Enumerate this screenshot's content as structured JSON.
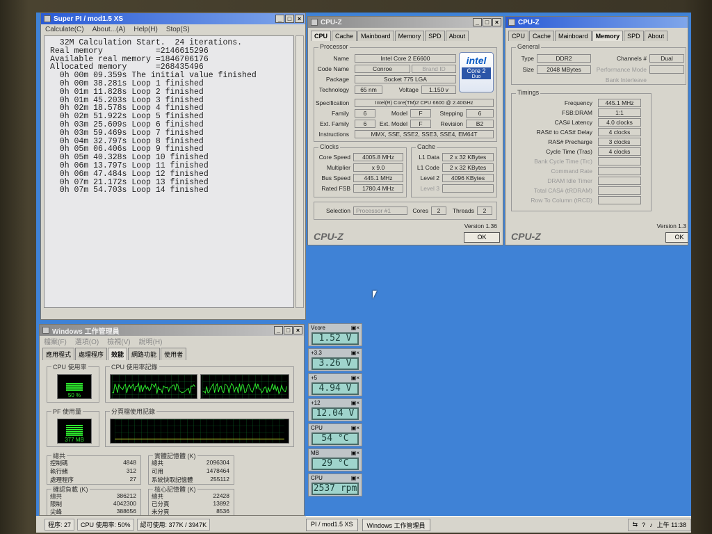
{
  "superpi": {
    "title": "Super PI / mod1.5 XS",
    "menu": [
      "Calculate(C)",
      "About...(A)",
      "Help(H)",
      "Stop(S)"
    ],
    "log": [
      "  32M Calculation Start.  24 iterations.",
      "Real memory           =2146615296",
      "Available real memory =1846706176",
      "Allocated memory      =268435496",
      "  0h 00m 09.359s The initial value finished",
      "  0h 00m 38.281s Loop 1 finished",
      "  0h 01m 11.828s Loop 2 finished",
      "  0h 01m 45.203s Loop 3 finished",
      "  0h 02m 18.578s Loop 4 finished",
      "  0h 02m 51.922s Loop 5 finished",
      "  0h 03m 25.609s Loop 6 finished",
      "  0h 03m 59.469s Loop 7 finished",
      "  0h 04m 32.797s Loop 8 finished",
      "  0h 05m 06.406s Loop 9 finished",
      "  0h 05m 40.328s Loop 10 finished",
      "  0h 06m 13.797s Loop 11 finished",
      "  0h 06m 47.484s Loop 12 finished",
      "  0h 07m 21.172s Loop 13 finished",
      "  0h 07m 54.703s Loop 14 finished"
    ]
  },
  "cpuz1": {
    "title": "CPU-Z",
    "tabs": [
      "CPU",
      "Cache",
      "Mainboard",
      "Memory",
      "SPD",
      "About"
    ],
    "processor_label": "Processor",
    "name_label": "Name",
    "name": "Intel Core 2 E6600",
    "codename_label": "Code Name",
    "codename": "Conroe",
    "brandid": "Brand ID",
    "package_label": "Package",
    "package": "Socket 775 LGA",
    "technology_label": "Technology",
    "technology": "65 nm",
    "voltage_label": "Voltage",
    "voltage": "1.150 v",
    "spec_label": "Specification",
    "spec": "Intel(R) Core(TM)2 CPU         6600  @ 2.40GHz",
    "family_label": "Family",
    "family": "6",
    "model_label": "Model",
    "model": "F",
    "stepping_label": "Stepping",
    "stepping": "6",
    "extfamily_label": "Ext. Family",
    "extfamily": "6",
    "extmodel_label": "Ext. Model",
    "extmodel": "F",
    "revision_label": "Revision",
    "revision": "B2",
    "instr_label": "Instructions",
    "instr": "MMX, SSE, SSE2, SSE3, SSE4, EM64T",
    "clocks_label": "Clocks",
    "corespeed_label": "Core Speed",
    "corespeed": "4005.8 MHz",
    "multiplier_label": "Multiplier",
    "multiplier": "x 9.0",
    "busspeed_label": "Bus Speed",
    "busspeed": "445.1 MHz",
    "ratedfsb_label": "Rated FSB",
    "ratedfsb": "1780.4 MHz",
    "cache_label": "Cache",
    "l1data_label": "L1 Data",
    "l1data": "2 x 32 KBytes",
    "l1code_label": "L1 Code",
    "l1code": "2 x 32 KBytes",
    "level2_label": "Level 2",
    "level2": "4096 KBytes",
    "level3_label": "Level 3",
    "selection_label": "Selection",
    "selection": "Processor #1",
    "cores_label": "Cores",
    "cores": "2",
    "threads_label": "Threads",
    "threads": "2",
    "version": "Version 1.36",
    "brand": "CPU-Z",
    "ok": "OK",
    "logo_intel": "intel",
    "logo_core2": "Core 2",
    "logo_duo": "Duo"
  },
  "cpuz2": {
    "title": "CPU-Z",
    "tabs": [
      "CPU",
      "Cache",
      "Mainboard",
      "Memory",
      "SPD",
      "About"
    ],
    "general_label": "General",
    "type_label": "Type",
    "type": "DDR2",
    "size_label": "Size",
    "size": "2048 MBytes",
    "channels_label": "Channels #",
    "channels": "Dual",
    "perfmode_label": "Performance Mode",
    "bankinter_label": "Bank Interleave",
    "timings_label": "Timings",
    "freq_label": "Frequency",
    "freq": "445.1 MHz",
    "fsbdram_label": "FSB:DRAM",
    "fsbdram": "1:1",
    "cas_label": "CAS# Latency",
    "cas": "4.0 clocks",
    "rcd_label": "RAS# to CAS# Delay",
    "rcd": "4 clocks",
    "rp_label": "RAS# Precharge",
    "rp": "3 clocks",
    "tras_label": "Cycle Time (Tras)",
    "tras": "4 clocks",
    "trc_label": "Bank Cycle Time (Trc)",
    "cr_label": "Command Rate",
    "idle_label": "DRAM Idle Timer",
    "rdram_label": "Total CAS# (tRDRAM)",
    "rcd2_label": "Row To Column (tRCD)",
    "version": "Version 1.3",
    "brand": "CPU-Z",
    "ok": "OK"
  },
  "taskmgr": {
    "title": "Windows 工作管理員",
    "menu": [
      "檔案(F)",
      "選項(O)",
      "檢視(V)",
      "說明(H)"
    ],
    "tabs": [
      "應用程式",
      "處理程序",
      "效能",
      "網路功能",
      "使用者"
    ],
    "cpu_usage_label": "CPU 使用率",
    "cpu_usage": "50 %",
    "cpu_history_label": "CPU 使用率記錄",
    "pf_label": "PF 使用量",
    "pf_value": "377 MB",
    "pf_history_label": "分頁檔使用記錄",
    "totals_label": "總共",
    "handles_label": "控制碼",
    "handles": "4848",
    "threads_label": "執行緒",
    "threads": "312",
    "processes_label": "處理程序",
    "processes": "27",
    "physmem_label": "實體記憶體 (K)",
    "phys_total_label": "總共",
    "phys_total": "2096304",
    "phys_avail_label": "可用",
    "phys_avail": "1478464",
    "phys_cache_label": "系統快取記憶體",
    "phys_cache": "255112",
    "commit_label": "確認負載 (K)",
    "commit_total_label": "總共",
    "commit_total": "386212",
    "commit_limit_label": "限制",
    "commit_limit": "4042300",
    "commit_peak_label": "尖峰",
    "commit_peak": "388656",
    "kernel_label": "核心記憶體 (K)",
    "kernel_total_label": "總共",
    "kernel_total": "22428",
    "kernel_paged_label": "已分頁",
    "kernel_paged": "13892",
    "kernel_nonpaged_label": "未分頁",
    "kernel_nonpaged": "8536",
    "status_processes": "程序: 27",
    "status_cpu": "CPU 使用率: 50%",
    "status_commit": "認可使用: 377K / 3947K"
  },
  "monitor": [
    {
      "label": "Vcore",
      "value": "1.52 V"
    },
    {
      "label": "+3.3",
      "value": "3.26 V"
    },
    {
      "label": "+5",
      "value": "4.94 V"
    },
    {
      "label": "+12",
      "value": "12.04 V"
    },
    {
      "label": "CPU",
      "value": "54 °C"
    },
    {
      "label": "MB",
      "value": "29 °C"
    },
    {
      "label": "CPU",
      "value": "2537 rpm"
    }
  ],
  "taskbar": {
    "task1": "PI / mod1.5 XS",
    "task2": "Windows 工作管理員",
    "clock": "上午 11:38"
  }
}
